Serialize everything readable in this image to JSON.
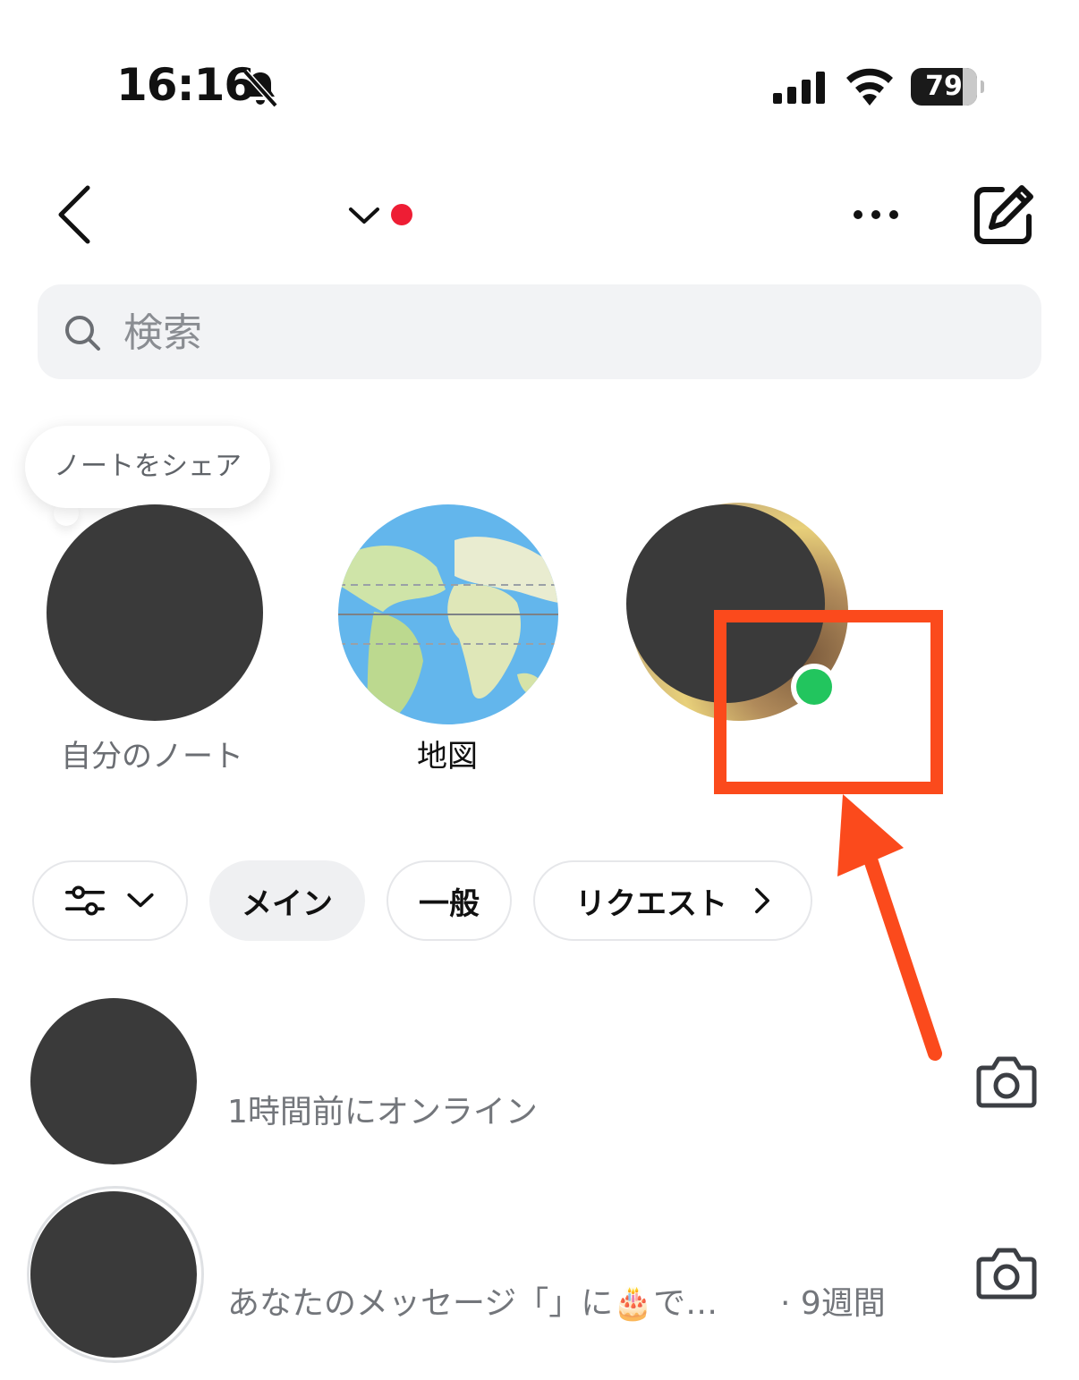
{
  "status_bar": {
    "time": "16:16",
    "battery_percent": 79
  },
  "header": {
    "account_indicator_color": "#ee1d34"
  },
  "search": {
    "placeholder": "検索"
  },
  "notes": {
    "share_bubble": "ノートをシェア",
    "items": [
      {
        "label": "自分のノート"
      },
      {
        "label": "地図"
      },
      {
        "label": ""
      }
    ],
    "online_color": "#22c55e"
  },
  "annotation": {
    "color": "#fb4a1c"
  },
  "tabs": [
    {
      "label": "",
      "icon": "filter-sliders-icon"
    },
    {
      "label": "メイン",
      "active": true
    },
    {
      "label": "一般"
    },
    {
      "label": "リクエスト"
    }
  ],
  "messages": [
    {
      "name": "",
      "subtitle": "1時間前にオンライン"
    },
    {
      "name": "",
      "subtitle": "あなたのメッセージ「」に🎂で…",
      "time": "· 9週間"
    }
  ]
}
